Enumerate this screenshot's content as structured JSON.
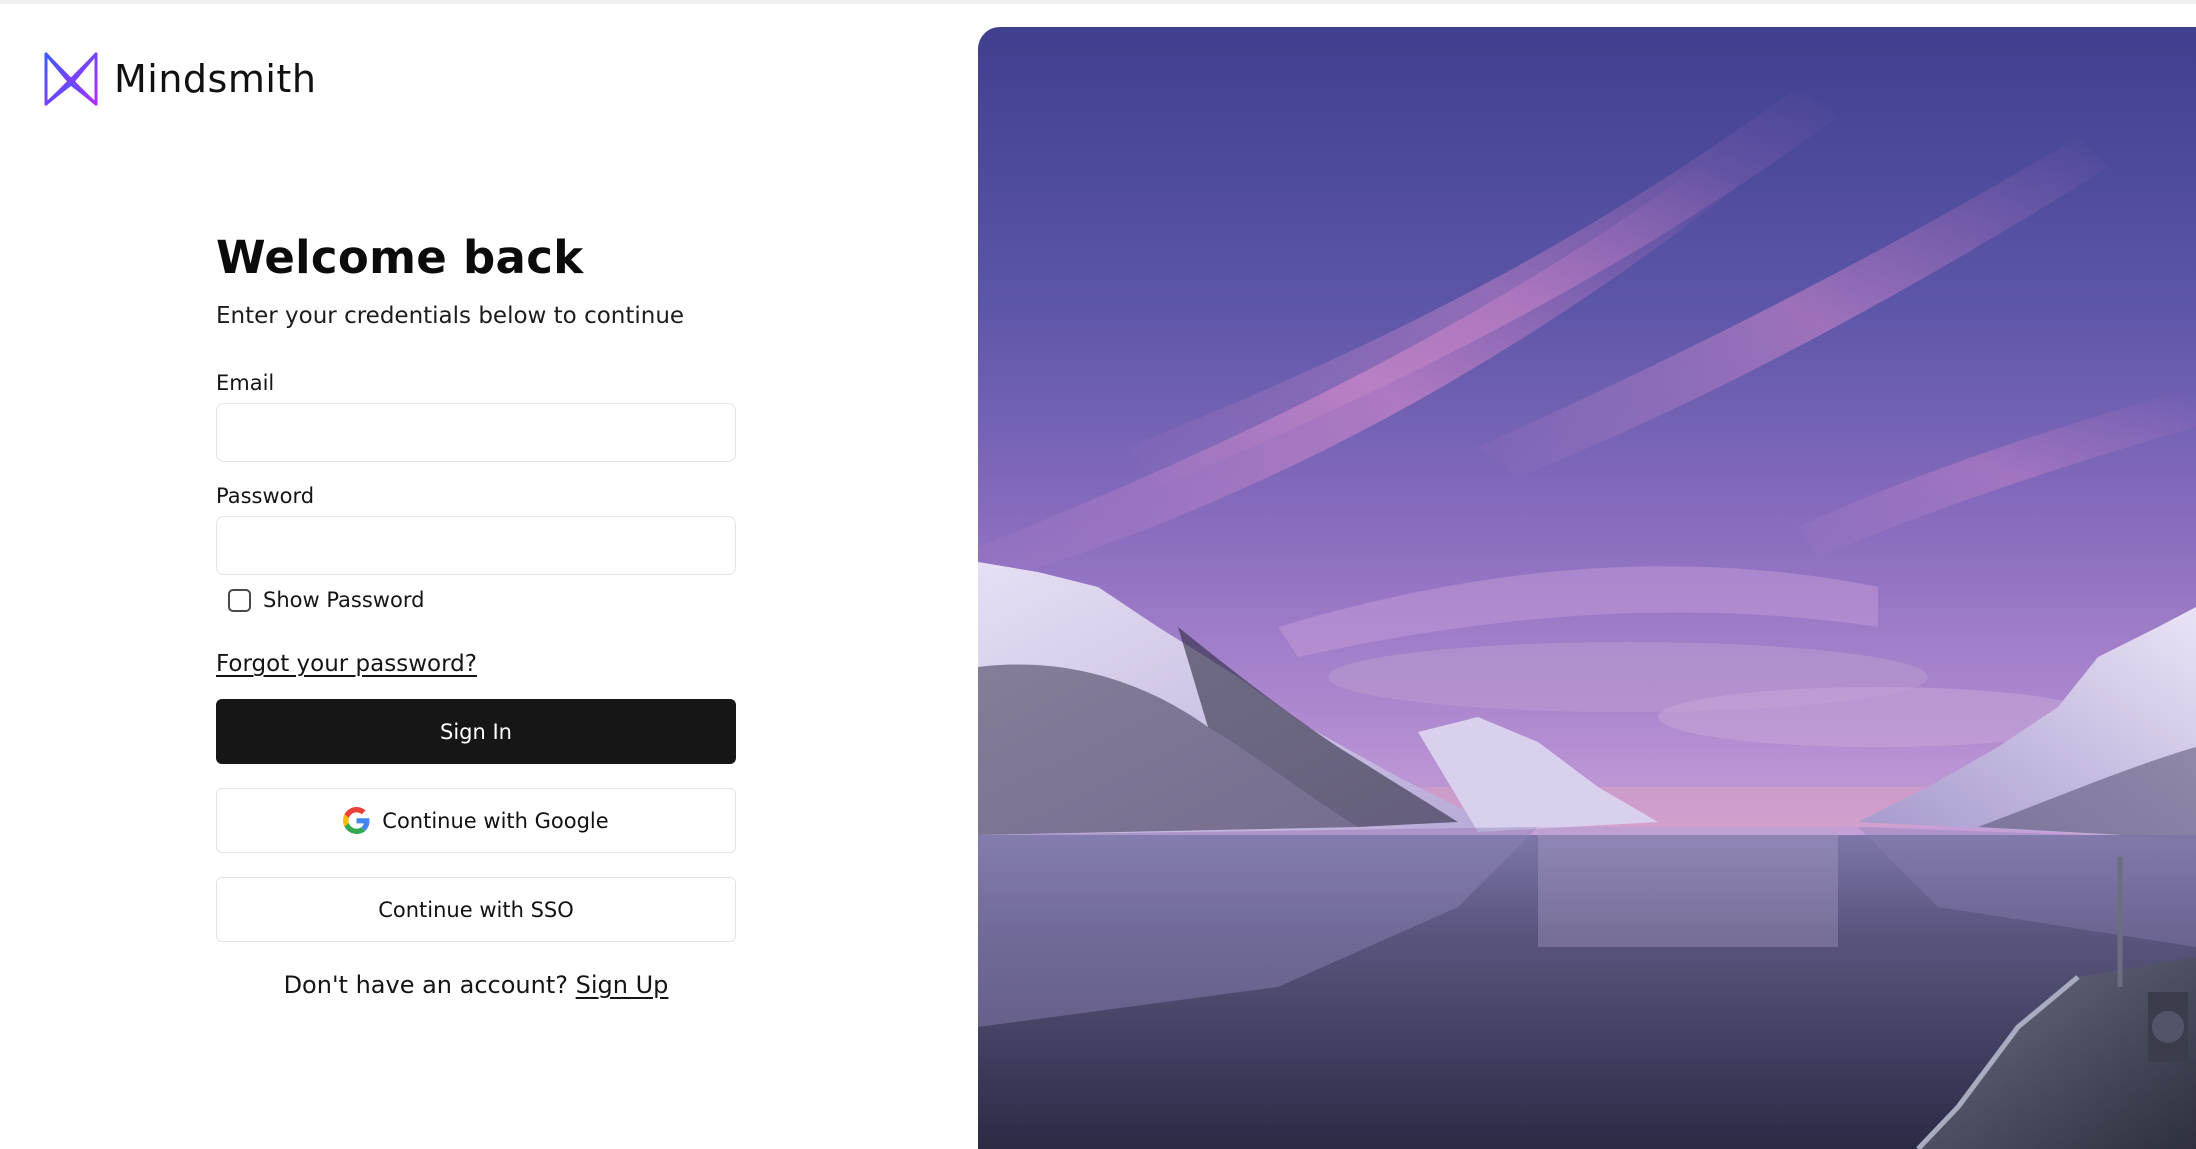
{
  "brand": {
    "name": "Mindsmith",
    "logo_icon": "mindsmith-m-logo-icon"
  },
  "login": {
    "title": "Welcome back",
    "subtitle": "Enter your credentials below to continue",
    "email_label": "Email",
    "email_value": "",
    "password_label": "Password",
    "password_value": "",
    "show_password_label": "Show Password",
    "show_password_checked": false,
    "forgot_password": "Forgot your password?",
    "sign_in": "Sign In",
    "google_button": "Continue with Google",
    "google_icon": "google-g-icon",
    "sso_button": "Continue with SSO",
    "no_account_text": "Don't have an account?",
    "sign_up": "Sign Up"
  },
  "hero": {
    "image": "snowy-fjord-sunset-photo"
  },
  "colors": {
    "primary_button": "#161616",
    "input_border": "#e3e3e6",
    "logo_gradient_start": "#3b5bff",
    "logo_gradient_end": "#a530ff"
  }
}
